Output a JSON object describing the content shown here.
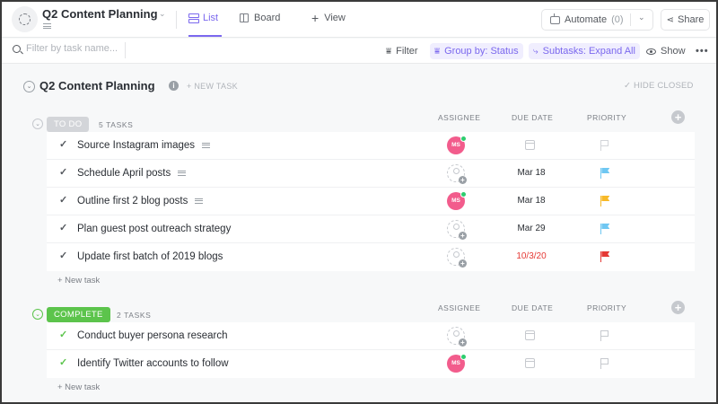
{
  "header": {
    "title": "Q2 Content Planning",
    "tabs": [
      {
        "label": "List",
        "active": true
      },
      {
        "label": "Board",
        "active": false
      }
    ],
    "add_view_label": "View",
    "automate_label": "Automate",
    "automate_count": "(0)",
    "share_label": "Share"
  },
  "toolbar": {
    "search_placeholder": "Filter by task name...",
    "filter_label": "Filter",
    "group_label": "Group by: Status",
    "subtasks_label": "Subtasks: Expand All",
    "show_label": "Show",
    "more_label": "•••"
  },
  "list": {
    "title": "Q2 Content Planning",
    "info_icon": "i",
    "new_task_label": "+ NEW TASK",
    "hide_closed_label": "✓ HIDE CLOSED"
  },
  "columns": {
    "assignee": "ASSIGNEE",
    "due_date": "DUE DATE",
    "priority": "PRIORITY"
  },
  "colors": {
    "accent": "#7b68ee",
    "todo": "#d3d5d9",
    "complete": "#5cc44c",
    "avatar": "#f25c8c",
    "priority_normal": "#6fc7f2",
    "priority_high": "#f7b928",
    "priority_urgent": "#e53935",
    "priority_none": "#d3d5d9"
  },
  "groups": [
    {
      "status": "TO DO",
      "count_label": "5 TASKS",
      "new_task_label": "+ New task",
      "tasks": [
        {
          "name": "Source Instagram images",
          "has_description": true,
          "assignee": "MS",
          "due": "",
          "priority": "none"
        },
        {
          "name": "Schedule April posts",
          "has_description": true,
          "assignee": "",
          "due": "Mar 18",
          "priority": "normal"
        },
        {
          "name": "Outline first 2 blog posts",
          "has_description": true,
          "assignee": "MS",
          "due": "Mar 18",
          "priority": "high"
        },
        {
          "name": "Plan guest post outreach strategy",
          "has_description": false,
          "assignee": "",
          "due": "Mar 29",
          "priority": "normal"
        },
        {
          "name": "Update first batch of 2019 blogs",
          "has_description": false,
          "assignee": "",
          "due": "10/3/20",
          "priority": "urgent",
          "overdue": true
        }
      ]
    },
    {
      "status": "COMPLETE",
      "count_label": "2 TASKS",
      "new_task_label": "+ New task",
      "tasks": [
        {
          "name": "Conduct buyer persona research",
          "has_description": false,
          "assignee": "",
          "due": "",
          "priority": "none"
        },
        {
          "name": "Identify Twitter accounts to follow",
          "has_description": false,
          "assignee": "MS",
          "due": "",
          "priority": "none"
        }
      ]
    }
  ]
}
